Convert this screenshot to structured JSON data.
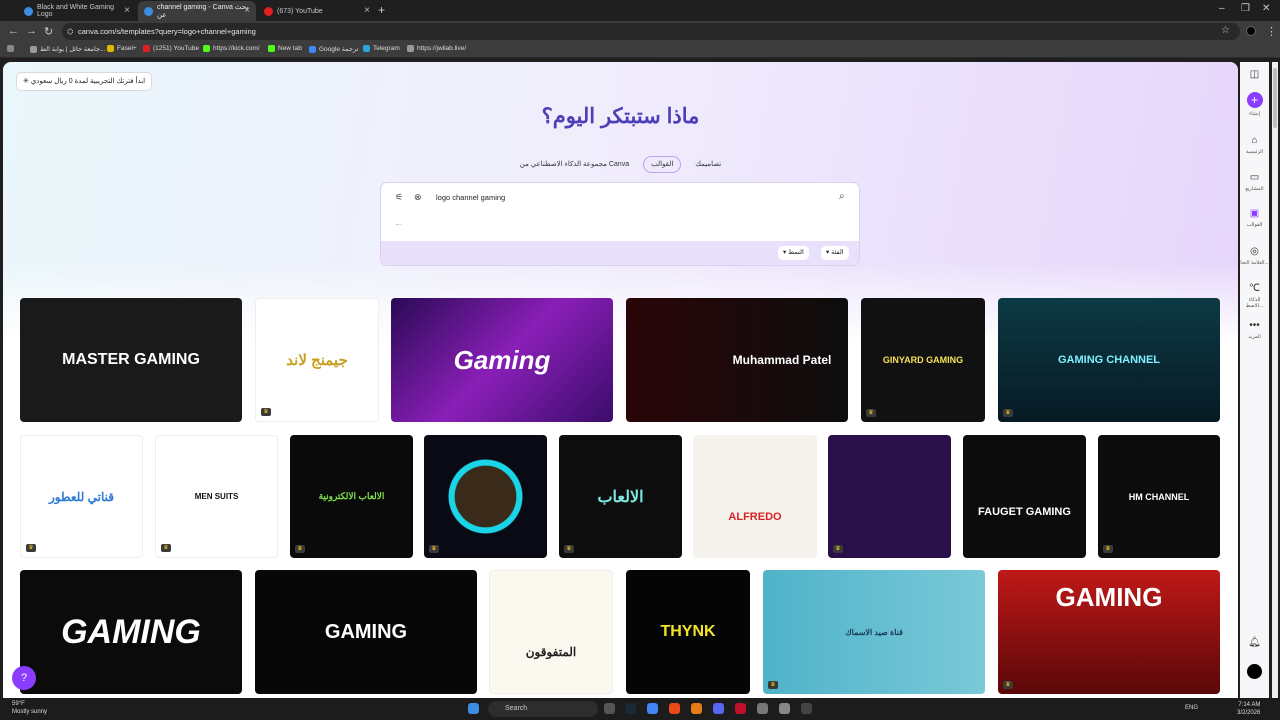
{
  "tabs": [
    {
      "label": "Black and White Gaming Logo",
      "color": "#3b8de0"
    },
    {
      "label": "channel gaming - Canva بحث عن",
      "color": "#3b8de0"
    },
    {
      "label": "(673) YouTube",
      "color": "#e02020"
    }
  ],
  "address": "canva.com/s/templates?query=logo+channel+gaming",
  "bookmarks": [
    "جامعة حائل | بوابة الط...",
    "Fasel+",
    "(1251) YouTube",
    "https://kick.com/",
    "New tab",
    "Google ترجمة",
    "Telegram",
    "https://jwilab.live/"
  ],
  "trial_banner": "ابدأ فترتك التجريبية لمدة 0 ريال سعودي",
  "headline": "ماذا ستبتكر اليوم؟",
  "modes": [
    "مجموعة الذكاء الاصطناعي من Canva",
    "القوالب",
    "تصاميمك"
  ],
  "search": {
    "query": "logo channel gaming",
    "filters": [
      "الفئة",
      "النمط"
    ]
  },
  "rail": [
    "إنشاء",
    "الرئيسية",
    "المشاريع",
    "القوالب",
    "العلامة التجا...",
    "الذكاء الاصط...",
    "المزيد"
  ],
  "templates": [
    "MASTER GAMING",
    "جيمنج لاند",
    "Gaming",
    "Muhammad Patel",
    "GINYARD GAMING",
    "GAMING CHANNEL",
    "قناتي للعطور",
    "MEN SUITS",
    "الالعاب الالكترونية",
    "",
    "الالعاب",
    "ALFREDO",
    "",
    "FAUGET GAMING",
    "HM CHANNEL",
    "GAMING",
    "GAMING",
    "المتفوقون",
    "THYNK",
    "قناة صيد الاسماك",
    "GAMING"
  ],
  "taskbar": {
    "weather_temp": "59°F",
    "weather_desc": "Mostly sunny",
    "search": "Search",
    "lang": "ENG",
    "time": "7:14 AM",
    "date": "3/2/2026"
  }
}
